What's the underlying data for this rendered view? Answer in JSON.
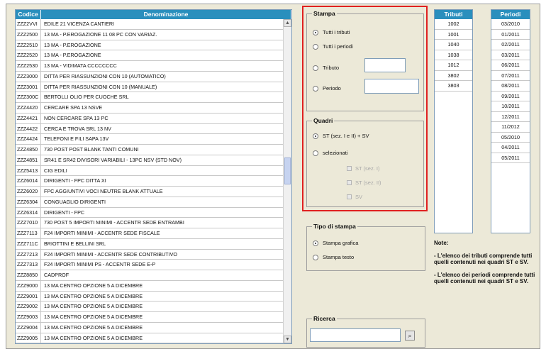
{
  "table": {
    "headers": {
      "codice": "Codice",
      "denominazione": "Denominazione"
    },
    "rows": [
      {
        "code": "ZZZ2VVI",
        "name": "EDILE 21 VICENZA CANTIERI"
      },
      {
        "code": "ZZZ2500",
        "name": "13 MA - P.EROGAZIONE 11 08 PC CON VARIAZ."
      },
      {
        "code": "ZZZ2510",
        "name": "13 MA - P.EROGAZIONE"
      },
      {
        "code": "ZZZ2520",
        "name": "13 MA - P.EROGAZIONE"
      },
      {
        "code": "ZZZ2530",
        "name": "13 MA - VIDIMATA CCCCCCCC"
      },
      {
        "code": "ZZZ3000",
        "name": "DITTA PER RIASSUNZIONI CON 10 (AUTOMATICO)"
      },
      {
        "code": "ZZZ3001",
        "name": "DITTA PER RIASSUNZIONI CON 10 (MANUALE)"
      },
      {
        "code": "ZZZ300C",
        "name": "BERTOLLI OLIO PER CUOCHE SRL"
      },
      {
        "code": "ZZZ4420",
        "name": "CERCARE SPA 13 NSVE"
      },
      {
        "code": "ZZZ4421",
        "name": "NON CERCARE SPA 13 PC"
      },
      {
        "code": "ZZZ4422",
        "name": "CERCA E TROVA SRL 13 NV"
      },
      {
        "code": "ZZZ4424",
        "name": "TELEFONI E FILI SAPA 13V"
      },
      {
        "code": "ZZZ4850",
        "name": "730 POST POST BLANK TANTI COMUNI"
      },
      {
        "code": "ZZZ4851",
        "name": "SR41 E SR42 DIVISORI VARIABILI - 13PC NSV (STD NOV)"
      },
      {
        "code": "ZZZ5413",
        "name": "CIG EDILI"
      },
      {
        "code": "ZZZ6014",
        "name": "DIRIGENTI - FPC DITTA XI"
      },
      {
        "code": "ZZZ6020",
        "name": "FPC AGGIUNTIVI VOCI NEUTRE BLANK ATTUALE"
      },
      {
        "code": "ZZZ6304",
        "name": "CONGUAGLIO DIRIGENTI"
      },
      {
        "code": "ZZZ6314",
        "name": "DIRIGENTI - FPC"
      },
      {
        "code": "ZZZ7010",
        "name": "730 POST 5 IMPORTI MINIMI - ACCENTR SEDE ENTRAMBI"
      },
      {
        "code": "ZZZ7113",
        "name": "F24 IMPORTI MINIMI - ACCENTR SEDE FISCALE"
      },
      {
        "code": "ZZZ711C",
        "name": "BRIOTTINI E BELLINI SRL"
      },
      {
        "code": "ZZZ7213",
        "name": "F24 IMPORTI MINIMI - ACCENTR SEDE CONTRIBUTIVO"
      },
      {
        "code": "ZZZ7313",
        "name": "F24 IMPORTI MINIMI PS - ACCENTR SEDE E-P"
      },
      {
        "code": "ZZZ8850",
        "name": "CADPROF"
      },
      {
        "code": "ZZZ9000",
        "name": "13 MA CENTRO OPZIONE 5 A DICEMBRE"
      },
      {
        "code": "ZZZ9001",
        "name": "13 MA CENTRO OPZIONE 5 A DICEMBRE"
      },
      {
        "code": "ZZZ9002",
        "name": "13 MA CENTRO OPZIONE 5 A DICEMBRE"
      },
      {
        "code": "ZZZ9003",
        "name": "13 MA CENTRO OPZIONE 5 A DICEMBRE"
      },
      {
        "code": "ZZZ9004",
        "name": "13 MA CENTRO OPZIONE 5 A DICEMBRE"
      },
      {
        "code": "ZZZ9005",
        "name": "13 MA CENTRO OPZIONE 5 A DICEMBRE"
      },
      {
        "code": "ZZZ9006",
        "name": "13 MA CENTRO OPZIONE 5 A DICEMBRE"
      }
    ]
  },
  "stampa": {
    "title": "Stampa",
    "tutti_tributi": "Tutti i tributi",
    "tutti_periodi": "Tutti i periodi",
    "tributo": "Tributo",
    "periodo": "Periodo",
    "selected": "tutti_tributi"
  },
  "quadri": {
    "title": "Quadri",
    "st_sv": "ST (sez. I e II) + SV",
    "selezionati": "selezionati",
    "st_sez1": "ST (sez. I)",
    "st_sez2": "ST (sez. II)",
    "sv": "SV",
    "selected": "st_sv"
  },
  "tipo": {
    "title": "Tipo di stampa",
    "grafica": "Stampa grafica",
    "testo": "Stampa testo",
    "selected": "grafica"
  },
  "ricerca": {
    "title": "Ricerca",
    "value": ""
  },
  "tributi": {
    "header": "Tributi",
    "items": [
      "1002",
      "1001",
      "1040",
      "1038",
      "1012",
      "3802",
      "3803"
    ]
  },
  "periodi": {
    "header": "Periodi",
    "items": [
      "03/2010",
      "01/2011",
      "02/2011",
      "03/2011",
      "06/2011",
      "07/2011",
      "08/2011",
      "09/2011",
      "10/2011",
      "12/2011",
      "11/2012",
      "05/2010",
      "04/2011",
      "05/2011"
    ]
  },
  "notes": {
    "title": "Note:",
    "p1": "- L'elenco dei tributi comprende tutti quelli contenuti nei quadri ST e SV.",
    "p2": "- L'elenco dei periodi comprende tutti quelli contenuti nei quadri ST e SV."
  },
  "colors": {
    "header": "#2a8fbd",
    "highlight": "#e02020",
    "panel": "#ece9d8"
  }
}
